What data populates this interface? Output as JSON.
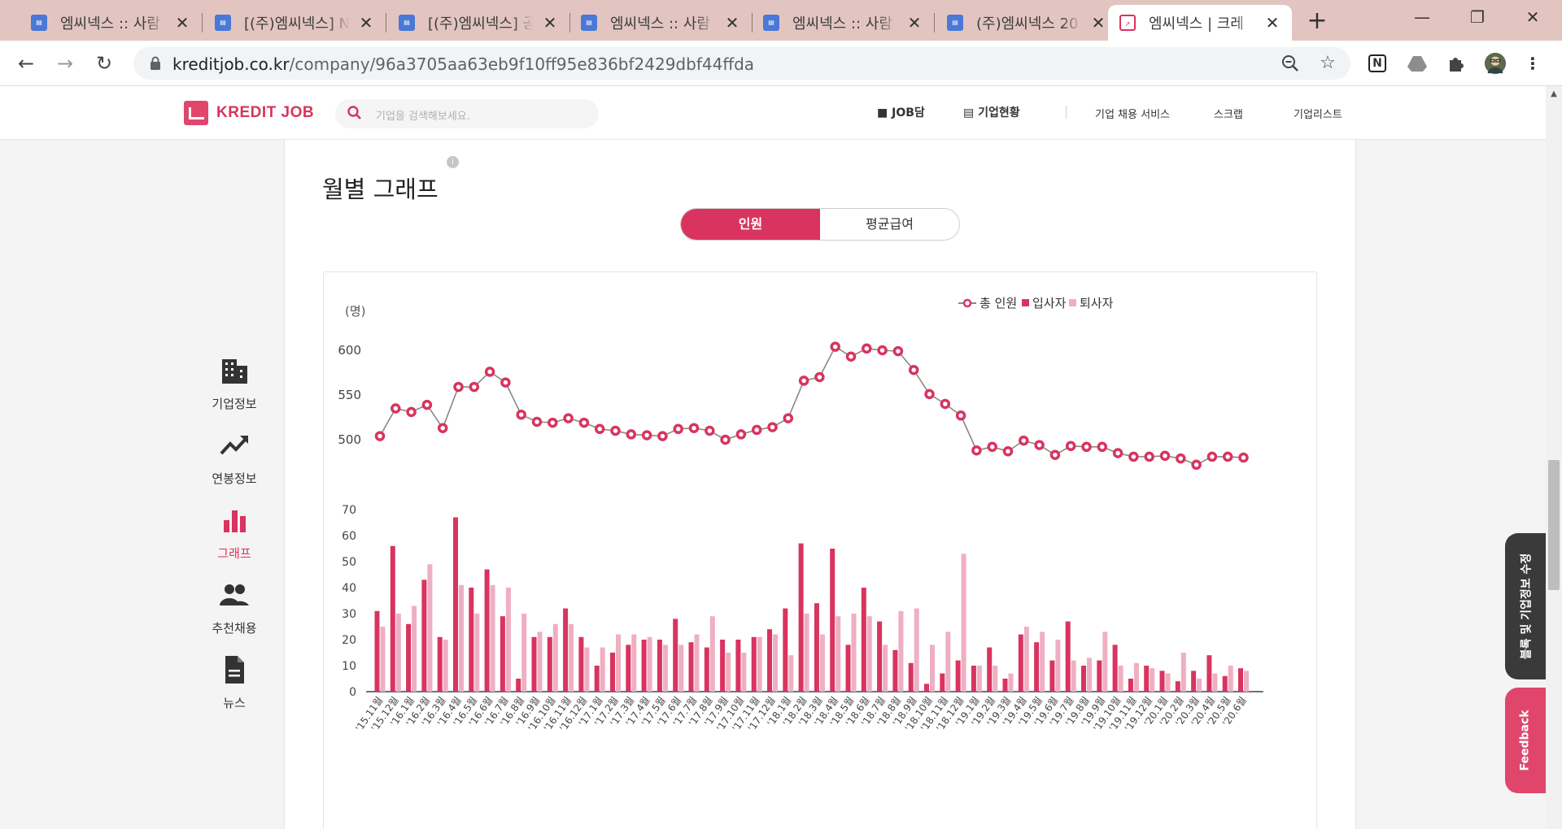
{
  "browser": {
    "tabs": [
      {
        "title": "엠씨넥스 :: 사람",
        "favicon": "saramin"
      },
      {
        "title": "[(주)엠씨넥스] N",
        "favicon": "saramin"
      },
      {
        "title": "[(주)엠씨넥스] 공",
        "favicon": "saramin"
      },
      {
        "title": "엠씨넥스 :: 사람",
        "favicon": "saramin"
      },
      {
        "title": "엠씨넥스 :: 사람",
        "favicon": "saramin"
      },
      {
        "title": "(주)엠씨넥스 20",
        "favicon": "saramin"
      },
      {
        "title": "엠씨넥스 | 크레",
        "favicon": "kreditjob"
      }
    ],
    "active_tab_index": 6,
    "favicon_text": "사람\nin",
    "url_domain": "kreditjob.co.kr",
    "url_path": "/company/96a3705aa63eb9f10ff95e836bf2429dbf44ffda"
  },
  "site": {
    "logo_text": "KREDIT JOB",
    "search_placeholder": "기업을 검색해보세요.",
    "nav": {
      "jobdam": "JOB담",
      "company_status": "기업현황",
      "hiring_service": "기업 채용 서비스",
      "scrap": "스크랩",
      "company_list": "기업리스트"
    }
  },
  "left_menu": [
    {
      "label": "기업정보",
      "icon": "building-icon",
      "active": false
    },
    {
      "label": "연봉정보",
      "icon": "trending-up-icon",
      "active": false
    },
    {
      "label": "그래프",
      "icon": "bar-chart-icon",
      "active": true
    },
    {
      "label": "추천채용",
      "icon": "people-icon",
      "active": false
    },
    {
      "label": "뉴스",
      "icon": "document-icon",
      "active": false
    }
  ],
  "section": {
    "title": "월별 그래프",
    "info": "i",
    "toggle": {
      "selected": "인원",
      "other": "평균급여"
    }
  },
  "side_tabs": {
    "edit": "블록 및 기업정보 수정",
    "feedback": "Feedback"
  },
  "colors": {
    "brand": "#d8345f",
    "join_bar": "#d8345f",
    "leave_bar": "#efafc2",
    "line": "#888888",
    "tab_bar": "#e2c5c1"
  },
  "chart_data": {
    "type": "line+bar",
    "unit_label": "(명)",
    "legend": {
      "position": "top-right",
      "items": [
        "총 인원",
        "입사자",
        "퇴사자"
      ]
    },
    "x": [
      "'15.11월",
      "'15.12월",
      "'16.1월",
      "'16.2월",
      "'16.3월",
      "'16.4월",
      "'16.5월",
      "'16.6월",
      "'16.7월",
      "'16.8월",
      "'16.9월",
      "'16.10월",
      "'16.11월",
      "'16.12월",
      "'17.1월",
      "'17.2월",
      "'17.3월",
      "'17.4월",
      "'17.5월",
      "'17.6월",
      "'17.7월",
      "'17.8월",
      "'17.9월",
      "'17.10월",
      "'17.11월",
      "'17.12월",
      "'18.1월",
      "'18.2월",
      "'18.3월",
      "'18.4월",
      "'18.5월",
      "'18.6월",
      "'18.7월",
      "'18.8월",
      "'18.9월",
      "'18.10월",
      "'18.11월",
      "'18.12월",
      "'19.1월",
      "'19.2월",
      "'19.3월",
      "'19.4월",
      "'19.5월",
      "'19.6월",
      "'19.7월",
      "'19.8월",
      "'19.9월",
      "'19.10월",
      "'19.11월",
      "'19.12월",
      "'20.1월",
      "'20.2월",
      "'20.3월",
      "'20.4월",
      "'20.5월",
      "'20.6월"
    ],
    "top_axis": {
      "ticks": [
        500,
        550,
        600
      ],
      "range": [
        470,
        600
      ]
    },
    "bottom_axis": {
      "ticks": [
        0,
        10,
        20,
        30,
        40,
        50,
        60,
        70
      ],
      "range": [
        0,
        70
      ]
    },
    "series": [
      {
        "name": "총 인원",
        "type": "line",
        "values": [
          504,
          535,
          531,
          539,
          513,
          559,
          559,
          576,
          564,
          528,
          520,
          519,
          524,
          519,
          512,
          510,
          506,
          505,
          504,
          512,
          513,
          510,
          500,
          506,
          511,
          514,
          524,
          566,
          570,
          604,
          593,
          602,
          600,
          599,
          578,
          551,
          540,
          527,
          488,
          492,
          487,
          499,
          494,
          483,
          493,
          492,
          492,
          485,
          481,
          481,
          482,
          479,
          472,
          481,
          481,
          480
        ]
      },
      {
        "name": "입사자",
        "type": "bar",
        "values": [
          31,
          56,
          26,
          43,
          21,
          67,
          40,
          47,
          29,
          5,
          21,
          21,
          32,
          21,
          10,
          15,
          18,
          20,
          20,
          28,
          19,
          17,
          20,
          20,
          21,
          24,
          32,
          57,
          34,
          55,
          18,
          40,
          27,
          16,
          11,
          3,
          7,
          12,
          10,
          17,
          5,
          22,
          19,
          12,
          27,
          10,
          12,
          18,
          5,
          10,
          8,
          4,
          8,
          14,
          6,
          9
        ]
      },
      {
        "name": "퇴사자",
        "type": "bar",
        "values": [
          25,
          30,
          33,
          49,
          20,
          41,
          30,
          41,
          40,
          30,
          23,
          26,
          26,
          17,
          17,
          22,
          22,
          21,
          18,
          18,
          22,
          29,
          15,
          15,
          21,
          22,
          14,
          30,
          22,
          29,
          30,
          29,
          18,
          31,
          32,
          18,
          23,
          53,
          10,
          10,
          7,
          25,
          23,
          20,
          12,
          13,
          23,
          10,
          11,
          9,
          7,
          15,
          5,
          7,
          10,
          8
        ]
      }
    ]
  }
}
